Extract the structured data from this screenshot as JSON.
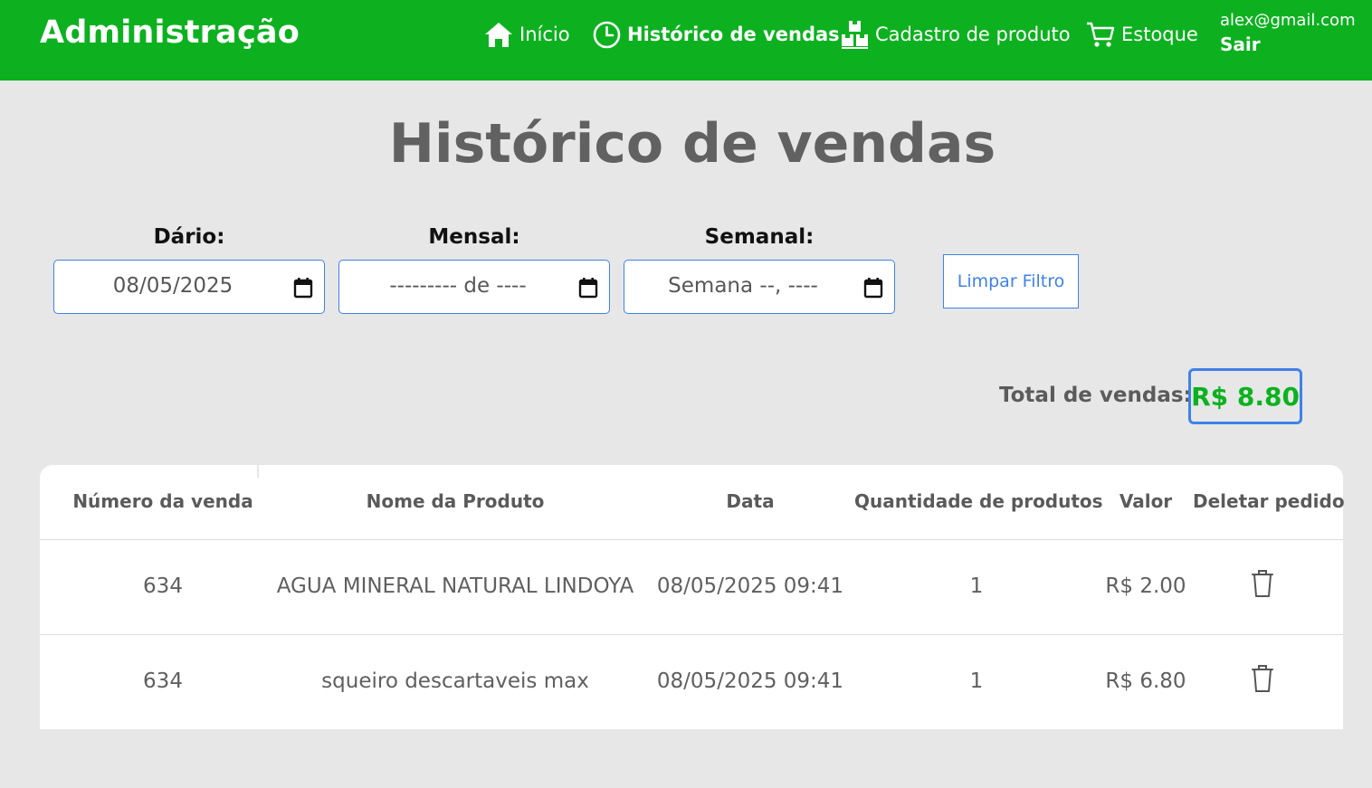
{
  "header": {
    "brand": "Administração",
    "nav": [
      {
        "label": "Início",
        "icon": "home-icon"
      },
      {
        "label": "Histórico de vendas",
        "icon": "clock-icon",
        "active": true
      },
      {
        "label": "Cadastro de produto",
        "icon": "boxes-icon"
      },
      {
        "label": "Estoque",
        "icon": "cart-icon"
      }
    ],
    "user_email": "alex@gmail.com",
    "logout": "Sair",
    "bg_color": "#0db120"
  },
  "page_title": "Histórico de vendas",
  "filters": {
    "daily": {
      "label": "Dário:",
      "value": "08/05/2025"
    },
    "monthly": {
      "label": "Mensal:",
      "value": "--------- de ----"
    },
    "weekly": {
      "label": "Semanal:",
      "value": "Semana --, ----"
    },
    "clear": "Limpar Filtro"
  },
  "total": {
    "label": "Total de vendas:",
    "value": "R$ 8.80"
  },
  "table": {
    "headers": [
      "Número da venda",
      "Nome da Produto",
      "Data",
      "Quantidade de produtos",
      "Valor",
      "Deletar pedido"
    ],
    "rows": [
      {
        "number": "634",
        "product": "AGUA MINERAL NATURAL LINDOYA",
        "date": "08/05/2025 09:41",
        "qty": "1",
        "value": "R$ 2.00"
      },
      {
        "number": "634",
        "product": "squeiro descartaveis max",
        "date": "08/05/2025 09:41",
        "qty": "1",
        "value": "R$ 6.80"
      }
    ]
  },
  "colors": {
    "accent": "#3f82e8",
    "green": "#0db120"
  }
}
